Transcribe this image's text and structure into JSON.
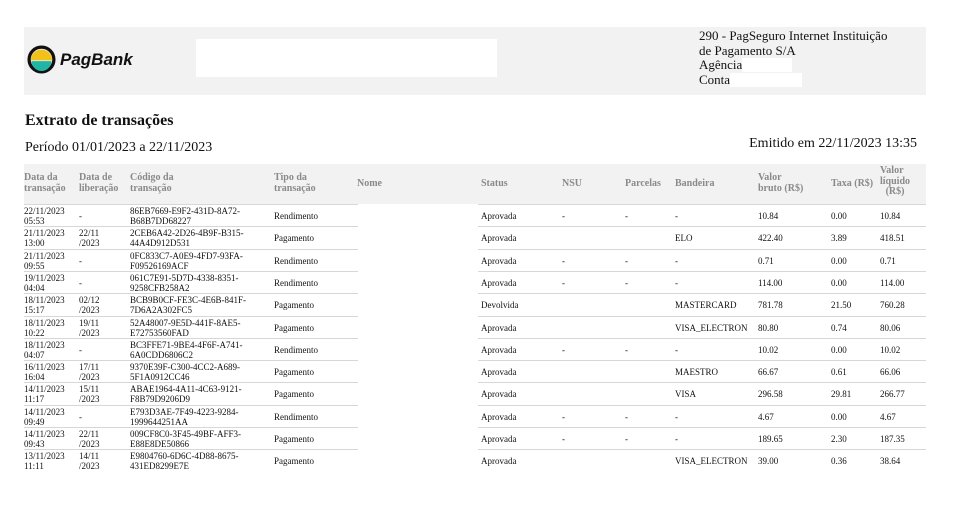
{
  "brand": {
    "name": "PagBank"
  },
  "bank_info": {
    "line1": "290 - PagSeguro Internet Instituição",
    "line2": "de Pagamento S/A",
    "agencia": "Agência",
    "conta": "Conta"
  },
  "title": "Extrato de transações",
  "period": "Período 01/01/2023 a 22/11/2023",
  "emitted": "Emitido em 22/11/2023 13:35",
  "columns": {
    "data_transacao": [
      "Data da",
      "transação"
    ],
    "data_liberacao": [
      "Data de",
      "liberação"
    ],
    "codigo": [
      "Código da",
      "transação"
    ],
    "tipo": [
      "Tipo da",
      "transação"
    ],
    "nome": "Nome",
    "status": "Status",
    "nsu": "NSU",
    "parcelas": "Parcelas",
    "bandeira": "Bandeira",
    "valor_bruto": [
      "Valor",
      "bruto (R$)"
    ],
    "taxa": "Taxa (R$)",
    "valor_liquido": [
      "Valor",
      "líquido",
      "(R$)"
    ]
  },
  "rows": [
    {
      "dt": [
        "22/11/2023",
        "05:53"
      ],
      "lib": [
        "-"
      ],
      "cod": [
        "86EB7669-E9F2-431D-8A72-",
        "B68B7DD68227"
      ],
      "tipo": "Rendimento",
      "status": "Aprovada",
      "nsu": "-",
      "parc": "-",
      "band": "-",
      "bruto": "10.84",
      "taxa": "0.00",
      "liq": "10.84"
    },
    {
      "dt": [
        "21/11/2023",
        "13:00"
      ],
      "lib": [
        "22/11",
        "/2023"
      ],
      "cod": [
        "2CEB6A42-2D26-4B9F-B315-",
        "44A4D912D531"
      ],
      "tipo": "Pagamento",
      "status": "Aprovada",
      "nsu": "",
      "parc": "",
      "band": "ELO",
      "bruto": "422.40",
      "taxa": "3.89",
      "liq": "418.51"
    },
    {
      "dt": [
        "21/11/2023",
        "09:55"
      ],
      "lib": [
        "-"
      ],
      "cod": [
        "0FC833C7-A0E9-4FD7-93FA-",
        "F09526169ACF"
      ],
      "tipo": "Rendimento",
      "status": "Aprovada",
      "nsu": "-",
      "parc": "-",
      "band": "-",
      "bruto": "0.71",
      "taxa": "0.00",
      "liq": "0.71"
    },
    {
      "dt": [
        "19/11/2023",
        "04:04"
      ],
      "lib": [
        "-"
      ],
      "cod": [
        "061C7E91-5D7D-4338-8351-",
        "9258CFB258A2"
      ],
      "tipo": "Rendimento",
      "status": "Aprovada",
      "nsu": "-",
      "parc": "-",
      "band": "-",
      "bruto": "114.00",
      "taxa": "0.00",
      "liq": "114.00"
    },
    {
      "dt": [
        "18/11/2023",
        "15:17"
      ],
      "lib": [
        "02/12",
        "/2023"
      ],
      "cod": [
        "BCB9B0CF-FE3C-4E6B-841F-",
        "7D6A2A302FC5"
      ],
      "tipo": "Pagamento",
      "status": "Devolvida",
      "nsu": "",
      "parc": "",
      "band": "MASTERCARD",
      "bruto": "781.78",
      "taxa": "21.50",
      "liq": "760.28"
    },
    {
      "dt": [
        "18/11/2023",
        "10:22"
      ],
      "lib": [
        "19/11",
        "/2023"
      ],
      "cod": [
        "52A48007-9E5D-441F-8AE5-",
        "E72753560FAD"
      ],
      "tipo": "Pagamento",
      "status": "Aprovada",
      "nsu": "",
      "parc": "",
      "band": "VISA_ELECTRON",
      "bruto": "80.80",
      "taxa": "0.74",
      "liq": "80.06"
    },
    {
      "dt": [
        "18/11/2023",
        "04:07"
      ],
      "lib": [
        "-"
      ],
      "cod": [
        "BC3FFE71-9BE4-4F6F-A741-",
        "6A0CDD6806C2"
      ],
      "tipo": "Rendimento",
      "status": "Aprovada",
      "nsu": "-",
      "parc": "-",
      "band": "-",
      "bruto": "10.02",
      "taxa": "0.00",
      "liq": "10.02"
    },
    {
      "dt": [
        "16/11/2023",
        "16:04"
      ],
      "lib": [
        "17/11",
        "/2023"
      ],
      "cod": [
        "9370E39F-C300-4CC2-A689-",
        "5F1A0912CC46"
      ],
      "tipo": "Pagamento",
      "status": "Aprovada",
      "nsu": "",
      "parc": "",
      "band": "MAESTRO",
      "bruto": "66.67",
      "taxa": "0.61",
      "liq": "66.06"
    },
    {
      "dt": [
        "14/11/2023",
        "11:17"
      ],
      "lib": [
        "15/11",
        "/2023"
      ],
      "cod": [
        "ABAE1964-4A11-4C63-9121-",
        "F8B79D9206D9"
      ],
      "tipo": "Pagamento",
      "status": "Aprovada",
      "nsu": "",
      "parc": "",
      "band": "VISA",
      "bruto": "296.58",
      "taxa": "29.81",
      "liq": "266.77"
    },
    {
      "dt": [
        "14/11/2023",
        "09:49"
      ],
      "lib": [
        "-"
      ],
      "cod": [
        "E793D3AE-7F49-4223-9284-",
        "1999644251AA"
      ],
      "tipo": "Rendimento",
      "status": "Aprovada",
      "nsu": "-",
      "parc": "-",
      "band": "-",
      "bruto": "4.67",
      "taxa": "0.00",
      "liq": "4.67"
    },
    {
      "dt": [
        "14/11/2023",
        "09:43"
      ],
      "lib": [
        "22/11",
        "/2023"
      ],
      "cod": [
        "009CF8C0-3F45-49BF-AFF3-",
        "E88E8DE50866"
      ],
      "tipo": "Pagamento",
      "status": "Aprovada",
      "nsu": "-",
      "parc": "-",
      "band": "-",
      "bruto": "189.65",
      "taxa": "2.30",
      "liq": "187.35"
    },
    {
      "dt": [
        "13/11/2023",
        "11:11"
      ],
      "lib": [
        "14/11",
        "/2023"
      ],
      "cod": [
        "E9804760-6D6C-4D88-8675-",
        "431ED8299E7E"
      ],
      "tipo": "Pagamento",
      "status": "Aprovada",
      "nsu": "",
      "parc": "",
      "band": "VISA_ELECTRON",
      "bruto": "39.00",
      "taxa": "0.36",
      "liq": "38.64"
    }
  ]
}
